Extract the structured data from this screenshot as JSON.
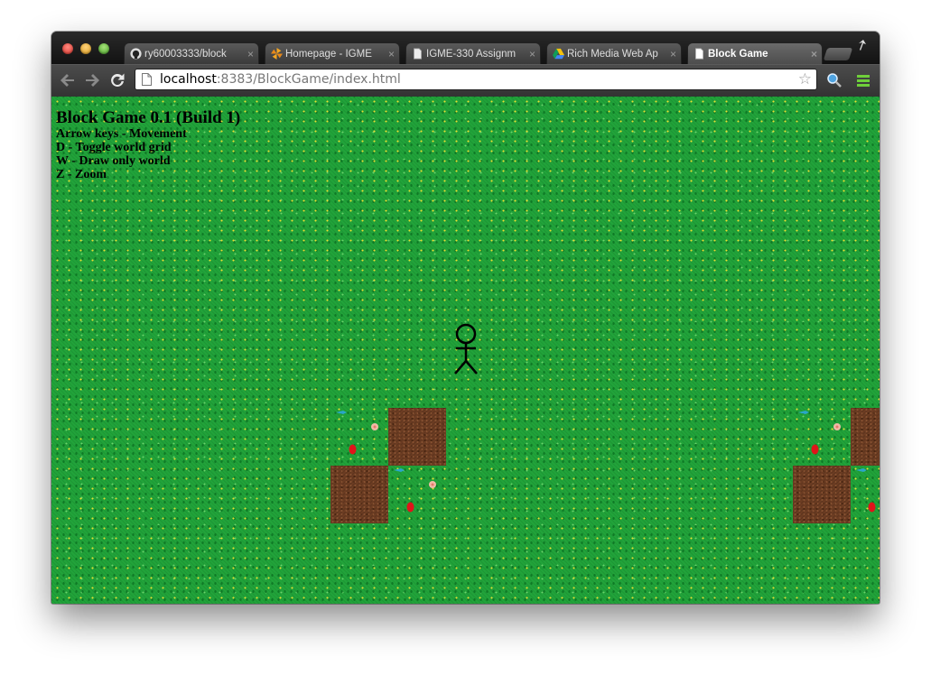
{
  "browser": {
    "tabs": [
      {
        "title": "ry60003333/block",
        "icon": "github-icon"
      },
      {
        "title": "Homepage - IGME",
        "icon": "pinwheel-icon"
      },
      {
        "title": "IGME-330 Assignm",
        "icon": "document-icon"
      },
      {
        "title": "Rich Media Web Ap",
        "icon": "google-drive-icon"
      },
      {
        "title": "Block Game",
        "icon": "document-icon",
        "active": true
      }
    ],
    "tab_close_glyph": "×",
    "address": {
      "host": "localhost",
      "rest": ":8383/BlockGame/index.html"
    },
    "bookmark_glyph": "☆"
  },
  "game": {
    "title": "Block Game 0.1 (Build 1)",
    "instructions": [
      "Arrow keys - Movement",
      "D - Toggle world grid",
      "W - Draw only world",
      "Z - Zoom"
    ],
    "colors": {
      "grass": "#21a33a",
      "dirt": "#6b3c22"
    }
  }
}
